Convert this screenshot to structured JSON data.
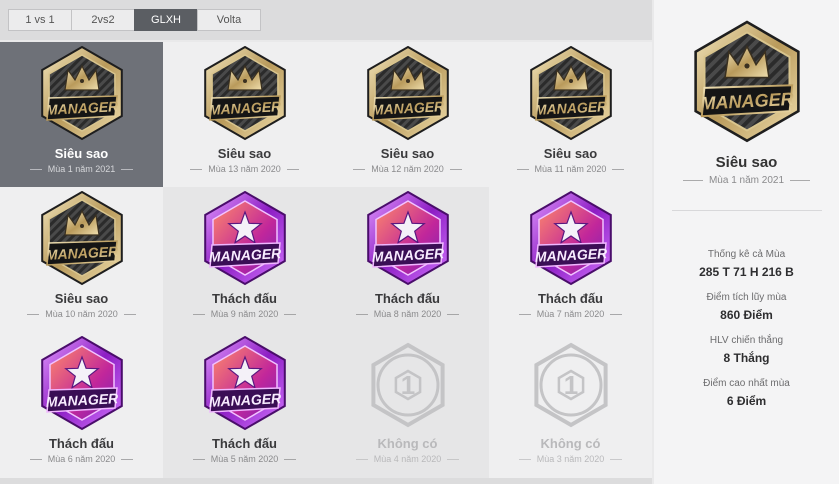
{
  "tabs": [
    {
      "label": "1 vs 1",
      "active": false
    },
    {
      "label": "2vs2",
      "active": false
    },
    {
      "label": "GLXH",
      "active": true
    },
    {
      "label": "Volta",
      "active": false
    }
  ],
  "seasons": [
    {
      "title": "Siêu sao",
      "subtitle": "Mùa 1 năm 2021",
      "badge": "manager-crown-badge"
    },
    {
      "title": "Siêu sao",
      "subtitle": "Mùa 13 năm 2020",
      "badge": "manager-crown-badge"
    },
    {
      "title": "Siêu sao",
      "subtitle": "Mùa 12 năm 2020",
      "badge": "manager-crown-badge"
    },
    {
      "title": "Siêu sao",
      "subtitle": "Mùa 11 năm 2020",
      "badge": "manager-crown-badge"
    },
    {
      "title": "Siêu sao",
      "subtitle": "Mùa 10 năm 2020",
      "badge": "manager-crown-badge"
    },
    {
      "title": "Thách đấu",
      "subtitle": "Mùa 9 năm 2020",
      "badge": "manager-star-badge"
    },
    {
      "title": "Thách đấu",
      "subtitle": "Mùa 8 năm 2020",
      "badge": "manager-star-badge"
    },
    {
      "title": "Thách đấu",
      "subtitle": "Mùa 7 năm 2020",
      "badge": "manager-star-badge"
    },
    {
      "title": "Thách đấu",
      "subtitle": "Mùa 6 năm 2020",
      "badge": "manager-star-badge"
    },
    {
      "title": "Thách đấu",
      "subtitle": "Mùa 5 năm 2020",
      "badge": "manager-star-badge"
    },
    {
      "title": "Không có",
      "subtitle": "Mùa 4 năm 2020",
      "badge": "empty-ball-badge"
    },
    {
      "title": "Không có",
      "subtitle": "Mùa 3 năm 2020",
      "badge": "empty-ball-badge"
    }
  ],
  "detail": {
    "title": "Siêu sao",
    "subtitle": "Mùa 1 năm 2021",
    "badge": "manager-crown-badge",
    "stats": [
      {
        "label": "Thống kê cả Mùa",
        "value": "285 T 71 H 216 B"
      },
      {
        "label": "Điểm tích lũy mùa",
        "value": "860 Điểm"
      },
      {
        "label": "HLV chiến thắng",
        "value": "8 Thắng"
      },
      {
        "label": "Điểm cao nhất mùa",
        "value": "6 Điểm"
      }
    ]
  },
  "badge_text": "MANAGER",
  "badge_digit": "1",
  "colors": {
    "selected": "#6e7178",
    "gold": "#c8b27a",
    "purple": "#a22fd6",
    "empty": "#c4c4c6"
  }
}
